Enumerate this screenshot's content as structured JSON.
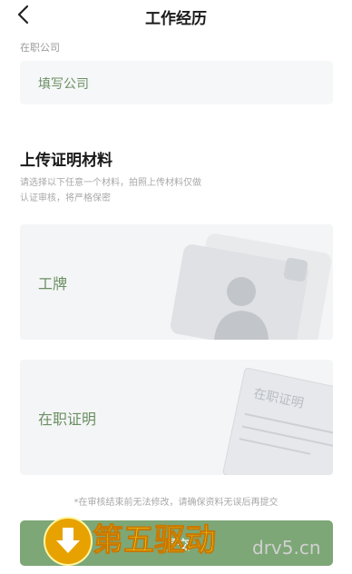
{
  "header": {
    "title": "工作经历"
  },
  "company": {
    "label": "在职公司",
    "placeholder": "填写公司"
  },
  "upload": {
    "title": "上传证明材料",
    "description": "请选择以下任意一个材料，拍照上传材料仅做认证审核，将严格保密",
    "cards": [
      {
        "label": "工牌",
        "icon": "badge-icon"
      },
      {
        "label": "在职证明",
        "icon": "certificate-icon",
        "doc_text": "在职证明"
      }
    ]
  },
  "notice": "*在审核结束前无法修改，请确保资料无误后再提交",
  "submit": {
    "label": "提交"
  },
  "watermark": {
    "text": "第五驱动",
    "url": "drv5.cn"
  }
}
